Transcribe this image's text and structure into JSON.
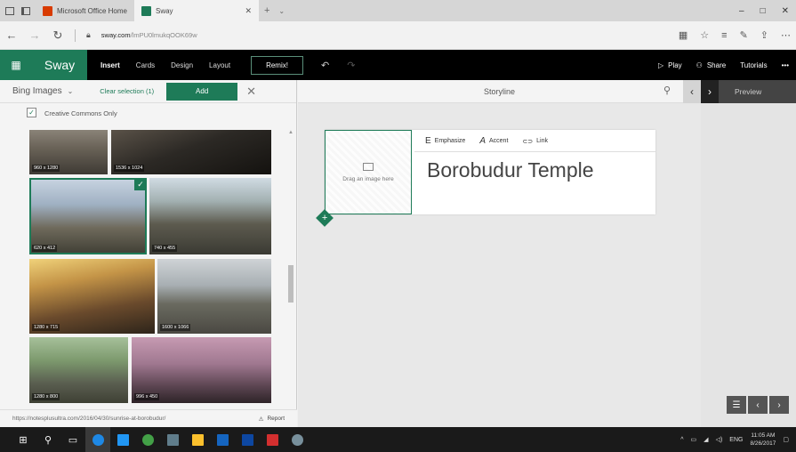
{
  "browser": {
    "tabs": [
      {
        "title": "Microsoft Office Home",
        "favicon_color": "#d83b01"
      },
      {
        "title": "Sway",
        "favicon_color": "#1e7b58"
      }
    ],
    "url_host": "sway.com",
    "url_path": "/lmPU0lmukqOOK69w",
    "window_controls": [
      "–",
      "□",
      "✕"
    ]
  },
  "sway": {
    "brand": "Sway",
    "menu": [
      "Insert",
      "Cards",
      "Design",
      "Layout"
    ],
    "selected_menu": "Insert",
    "remix": "Remix!",
    "play": "Play",
    "share": "Share",
    "tutorials": "Tutorials",
    "more": "•••",
    "accent": "#1e7b58"
  },
  "insert_pane": {
    "source": "Bing Images",
    "clear_selection": "Clear selection (1)",
    "add": "Add",
    "creative_commons": "Creative Commons Only",
    "creative_commons_checked": true,
    "images": [
      {
        "dims": "960 x 1280",
        "selected": false
      },
      {
        "dims": "1536 x 1024",
        "selected": false
      },
      {
        "dims": "620 x 412",
        "selected": true
      },
      {
        "dims": "740 x 455",
        "selected": false
      },
      {
        "dims": "1280 x 715",
        "selected": false
      },
      {
        "dims": "1600 x 1066",
        "selected": false
      },
      {
        "dims": "1280 x 800",
        "selected": false
      },
      {
        "dims": "996 x 450",
        "selected": false
      }
    ],
    "attribution_url": "https://notesplusultra.com/2016/04/30/sunrise-at-borobudur/",
    "report": "Report"
  },
  "storyline": {
    "title": "Storyline",
    "card": {
      "drop_text": "Drag an image here",
      "heading": "Borobudur Temple",
      "format_buttons": [
        {
          "glyph": "E",
          "label": "Emphasize"
        },
        {
          "glyph": "A",
          "label": "Accent"
        },
        {
          "glyph": "⊂⊃",
          "label": "Link"
        }
      ]
    }
  },
  "preview": {
    "label": "Preview"
  },
  "taskbar": {
    "time": "11:05 AM",
    "date": "8/26/2017",
    "lang": "ENG"
  }
}
